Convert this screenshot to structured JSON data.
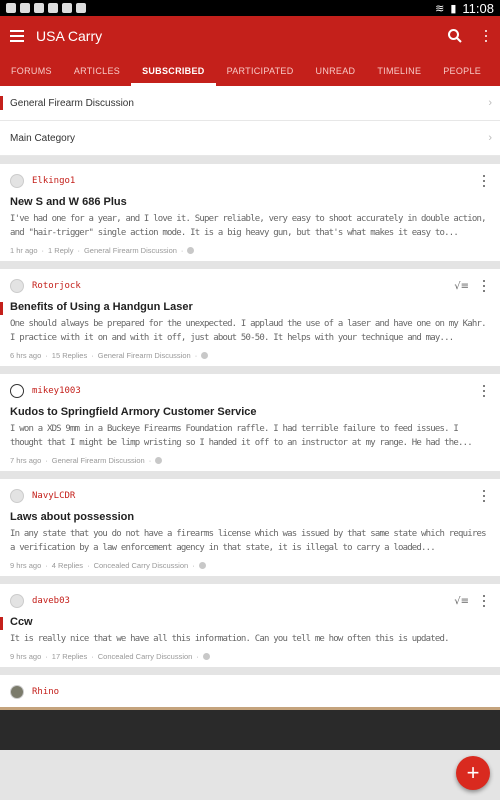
{
  "status_bar": {
    "time": "11:08"
  },
  "app_bar": {
    "title": "USA Carry",
    "menu_icon": "hamburger-icon",
    "search_icon": "search-icon",
    "overflow_icon": "more-vert-icon"
  },
  "tabs": [
    {
      "label": "FORUMS"
    },
    {
      "label": "ARTICLES"
    },
    {
      "label": "SUBSCRIBED"
    },
    {
      "label": "PARTICIPATED"
    },
    {
      "label": "UNREAD"
    },
    {
      "label": "TIMELINE"
    },
    {
      "label": "PEOPLE"
    }
  ],
  "active_tab": "SUBSCRIBED",
  "categories": [
    {
      "label": "General Firearm Discussion"
    },
    {
      "label": "Main Category"
    }
  ],
  "topics": [
    {
      "author": "Elkingo1",
      "title": "New S and W 686 Plus",
      "excerpt": "I've had one for a year, and I love it. Super reliable, very easy to shoot accurately in double action, and \"hair-trigger\" single action mode. It is a big heavy gun, but that's what makes it easy to...",
      "time": "1 hr ago",
      "replies": "1 Reply",
      "forum": "General Firearm Discussion"
    },
    {
      "author": "Rotorjock",
      "title": "Benefits of Using a Handgun Laser",
      "excerpt": "One should always be prepared for the unexpected. I applaud the use of a laser and have one on my Kahr. I practice with it on and with it off, just about 50-50. It helps with your technique and may...",
      "time": "6 hrs ago",
      "replies": "15 Replies",
      "forum": "General Firearm Discussion"
    },
    {
      "author": "mikey1003",
      "title": "Kudos to Springfield Armory Customer Service",
      "excerpt": "I won a XDS 9mm in a Buckeye Firearms Foundation raffle. I had terrible failure to feed issues. I thought that I might be limp wristing so I handed it off to an instructor at my range. He had the...",
      "time": "7 hrs ago",
      "replies": "",
      "forum": "General Firearm Discussion"
    },
    {
      "author": "NavyLCDR",
      "title": "Laws about possession",
      "excerpt": "In any state that you do not have a firearms license which was issued by that same state which requires a verification by a law enforcement agency in that state, it is illegal to carry a loaded...",
      "time": "9 hrs ago",
      "replies": "4 Replies",
      "forum": "Concealed Carry Discussion"
    },
    {
      "author": "daveb03",
      "title": "Ccw",
      "excerpt": "It is really nice that we have all this information. Can you tell me how often this is updated.",
      "time": "9 hrs ago",
      "replies": "17 Replies",
      "forum": "Concealed Carry Discussion"
    },
    {
      "author": "Rhino"
    }
  ],
  "fab": {
    "label": "+"
  }
}
